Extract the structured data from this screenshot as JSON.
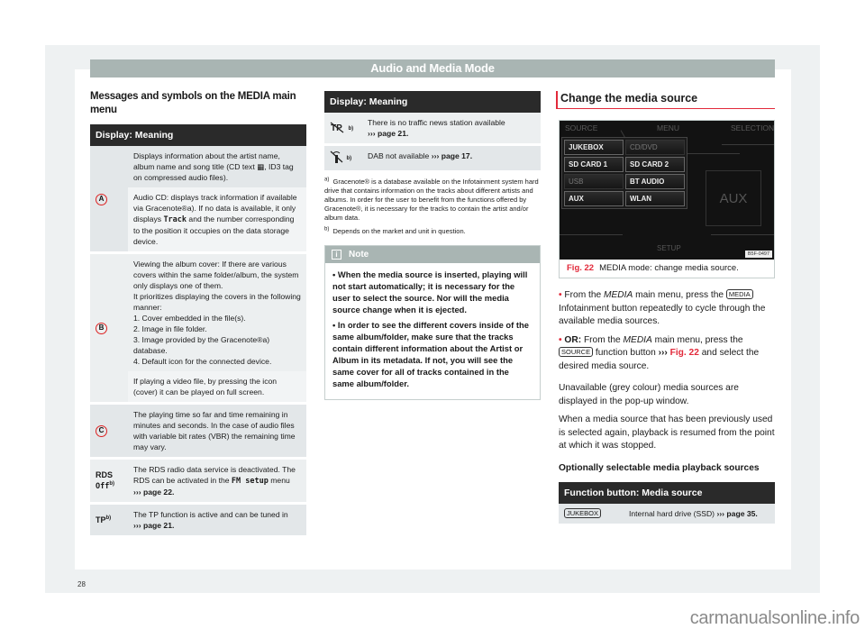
{
  "header": {
    "title": "Audio and Media Mode"
  },
  "left": {
    "section_title": "Messages and symbols on the MEDIA main menu",
    "table_header": "Display: Meaning",
    "rows": [
      {
        "symbol": "A",
        "texts": [
          "Displays information about the artist name, album name and song title (CD text ▦, ID3 tag on compressed audio files).",
          "Audio CD: displays track information if available via Gracenote®a). If no data is available, it only displays Track and the number corresponding to the position it occupies on the data storage device."
        ]
      },
      {
        "symbol": "B",
        "texts": [
          "Viewing the album cover: If there are various covers within the same folder/album, the system only displays one of them.",
          "It prioritizes displaying the covers in the following manner:",
          "1. Cover embedded in the file(s).",
          "2. Image in file folder.",
          "3. Image provided by the Gracenote®a) database.",
          "4. Default icon for the connected device.",
          "If playing a video file, by pressing the icon (cover) it can be played on full screen."
        ]
      },
      {
        "symbol": "C",
        "texts": [
          "The playing time so far and time remaining in minutes and seconds. In the case of audio files with variable bit rates (VBR) the remaining time may vary."
        ]
      },
      {
        "symbol": "RDS Off",
        "sup": "b)",
        "text_pre": "The RDS radio data service is deactivated. The RDS can be activated in the ",
        "mono": "FM setup",
        "text_post": " menu",
        "link": "››› page 22."
      },
      {
        "symbol": "TP",
        "sup": "b)",
        "text": "The TP function is active and can be tuned in",
        "link": "››› page 21."
      }
    ]
  },
  "middle": {
    "table_header": "Display: Meaning",
    "rows": [
      {
        "icon": "no-traffic-station-icon",
        "sup": "b)",
        "text": "There is no traffic news station available",
        "link": "››› page 21."
      },
      {
        "icon": "dab-not-available-icon",
        "sup": "b)",
        "text": "DAB not available",
        "link": "››› page 17."
      }
    ],
    "footnotes": [
      {
        "mark": "a)",
        "text": "Gracenote® is a database available on the Infotainment system hard drive that contains information on the tracks about different artists and albums. In order for the user to benefit from the functions offered by Gracenote®, it is necessary for the tracks to contain the artist and/or album data."
      },
      {
        "mark": "b)",
        "text": "Depends on the market and unit in question."
      }
    ],
    "note": {
      "title": "Note",
      "items": [
        "• When the media source is inserted, playing will not start automatically; it is necessary for the user to select the source. Nor will the media source change when it is ejected.",
        "• In order to see the different covers inside of the same album/folder, make sure that the tracks contain different information about the Artist or Album in its metadata. If not, you will see the same cover for all of tracks contained in the same album/folder."
      ]
    }
  },
  "right": {
    "section_title": "Change the media source",
    "screen": {
      "tabs": [
        "SOURCE",
        "MENU",
        "SELECTION"
      ],
      "buttons": [
        {
          "label": "JUKEBOX",
          "enabled": true
        },
        {
          "label": "CD/DVD",
          "enabled": false
        },
        {
          "label": "SD CARD 1",
          "enabled": true
        },
        {
          "label": "SD CARD 2",
          "enabled": true
        },
        {
          "label": "USB",
          "enabled": false
        },
        {
          "label": "BT AUDIO",
          "enabled": true
        },
        {
          "label": "AUX",
          "enabled": true
        },
        {
          "label": "WLAN",
          "enabled": true
        }
      ],
      "current_source": "AUX",
      "bottom_tab": "SETUP",
      "code": "B5F-0497"
    },
    "figure": {
      "number": "Fig. 22",
      "caption": "MEDIA mode: change media source."
    },
    "step1": {
      "pre": "From the ",
      "italic": "MEDIA",
      "mid": " main menu, press the ",
      "key": "MEDIA",
      "post": " Infotainment button repeatedly to cycle through the available media sources."
    },
    "step2": {
      "lead": "OR:",
      "pre": " From the ",
      "italic": "MEDIA",
      "mid": " main menu, press the ",
      "key": "SOURCE",
      "post1": " function button ",
      "arrow": "›››",
      "link": "Fig. 22",
      "post2": " and select the desired media source."
    },
    "para1": "Unavailable (grey colour) media sources are displayed in the pop-up window.",
    "para2": "When a media source that has been previously used is selected again, playback is resumed from the point at which it was stopped.",
    "subhead": "Optionally selectable media playback sources",
    "table_header": "Function button: Media source",
    "table_rows": [
      {
        "key": "JUKEBOX",
        "text": "Internal hard drive (SSD)",
        "link": "››› page 35."
      }
    ]
  },
  "page_number": "28",
  "watermark": "carmanualsonline.info",
  "colors": {
    "accent_red": "#e2293a",
    "header_gray": "#a9b5b3",
    "table_header": "#2a2a2a"
  }
}
